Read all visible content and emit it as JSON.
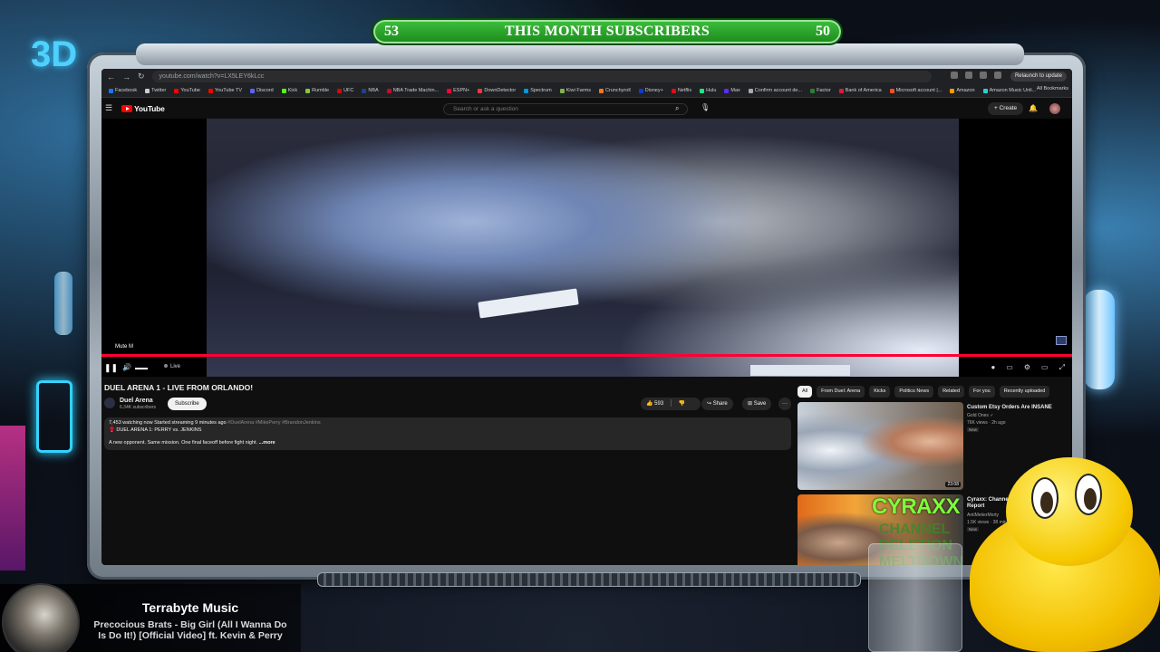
{
  "overlay": {
    "subscriber_bar": {
      "left_count": "53",
      "label": "THIS MONTH SUBSCRIBERS",
      "right_count": "50"
    },
    "sign_text": "3D",
    "now_playing": {
      "title": "Terrabyte Music",
      "song": "Precocious Brats - Big Girl (All I Wanna Do Is Do It!) [Official Video] ft. Kevin & Perry"
    }
  },
  "browser": {
    "url": "youtube.com/watch?v=LX5LEY6kLcc",
    "relaunch_label": "Relaunch to update",
    "bookmarks": [
      {
        "label": "Facebook",
        "color": "#1877f2"
      },
      {
        "label": "Twitter",
        "color": "#cccccc"
      },
      {
        "label": "YouTube",
        "color": "#ff0000"
      },
      {
        "label": "YouTube TV",
        "color": "#ff0000"
      },
      {
        "label": "Discord",
        "color": "#5865f2"
      },
      {
        "label": "Kick",
        "color": "#53fc18"
      },
      {
        "label": "Rumble",
        "color": "#85c742"
      },
      {
        "label": "UFC",
        "color": "#d20a0a"
      },
      {
        "label": "NBA",
        "color": "#1d428a"
      },
      {
        "label": "NBA Trade Machin...",
        "color": "#c9082a"
      },
      {
        "label": "ESPN+",
        "color": "#ff0033"
      },
      {
        "label": "DownDetector",
        "color": "#e83a3a"
      },
      {
        "label": "Spectrum",
        "color": "#0099d8"
      },
      {
        "label": "Kiwi Farms",
        "color": "#7fb24a"
      },
      {
        "label": "Crunchyroll",
        "color": "#f47521"
      },
      {
        "label": "Disney+",
        "color": "#113ccf"
      },
      {
        "label": "Netflix",
        "color": "#e50914"
      },
      {
        "label": "Hulu",
        "color": "#1ce783"
      },
      {
        "label": "Max",
        "color": "#5c2dff"
      },
      {
        "label": "Confirm account de...",
        "color": "#aaaaaa"
      },
      {
        "label": "Factor",
        "color": "#2e7d32"
      },
      {
        "label": "Bank of America",
        "color": "#e31837"
      },
      {
        "label": "Microsoft account |...",
        "color": "#f25022"
      },
      {
        "label": "Amazon",
        "color": "#ff9900"
      },
      {
        "label": "Amazon Music Unli...",
        "color": "#25d1da"
      }
    ],
    "all_bookmarks_label": "All Bookmarks"
  },
  "youtube": {
    "logo_text": "YouTube",
    "search_placeholder": "Search or ask a question",
    "create_label": "+ Create",
    "player": {
      "mute_tooltip": "Mute  M",
      "live_label": "Live"
    },
    "video": {
      "title": "DUEL ARENA 1 - LIVE FROM ORLANDO!",
      "channel_name": "Duel Arena",
      "channel_subs": "6.34K subscribers",
      "subscribe_label": "Subscribe",
      "likes": "593",
      "share_label": "Share",
      "save_label": "Save",
      "more_label": "···",
      "watching": "7,453 watching now  Started streaming 9 minutes ago",
      "hashtags": "#DuelArena #MikePerry #BrandonJenkins",
      "desc_line2": "🥊 DUEL ARENA 1: PERRY vs. JENKINS",
      "desc_line3": "A new opponent. Same mission. One final faceoff before fight night.",
      "desc_more": "...more"
    },
    "chips": [
      {
        "label": "All",
        "active": true
      },
      {
        "label": "From Duel: Arena",
        "active": false
      },
      {
        "label": "Kicks",
        "active": false
      },
      {
        "label": "Politics News",
        "active": false
      },
      {
        "label": "Related",
        "active": false
      },
      {
        "label": "For you",
        "active": false
      },
      {
        "label": "Recently uploaded",
        "active": false
      }
    ],
    "recommendations": [
      {
        "title": "Custom Etsy Orders Are INSANE",
        "channel": "Gold Ones ✓",
        "views": "76K views · 2h ago",
        "badge": "New",
        "duration": "23:08"
      },
      {
        "title": "Cyraxx: Channel Deletion Lolcow Report",
        "channel": "AntiMetierMorty",
        "views": "1.5K views · 38 min ago",
        "badge": "New",
        "thumb_text": "CYRAXX",
        "thumb_text2": "CHANNEL DELETION MELTDOWN"
      }
    ]
  }
}
